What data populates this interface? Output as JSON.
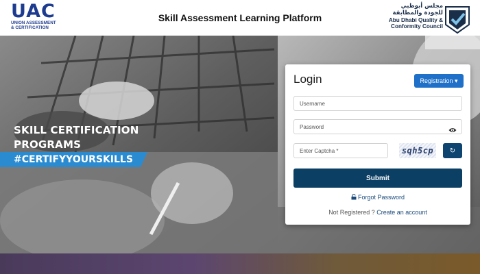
{
  "header": {
    "left_logo": {
      "mark": "UAC",
      "line1": "UNION ASSESSMENT",
      "line2": "& CERTIFICATION"
    },
    "title": "Skill Assessment Learning Platform",
    "right_logo": {
      "arabic_line1": "مجلس أبوظبي",
      "arabic_line2": "للجودة والمطابقة",
      "english_line1": "Abu Dhabi Quality &",
      "english_line2": "Conformity Council"
    }
  },
  "hero": {
    "caption_line1": "SKILL CERTIFICATION",
    "caption_line2": "PROGRAMS",
    "hashtag": "#CERTIFYYOURSKILLS"
  },
  "login": {
    "title": "Login",
    "registration_label": "Registration",
    "username_placeholder": "Username",
    "password_placeholder": "Password",
    "captcha_placeholder": "Enter Captcha *",
    "captcha_text": "sqh5cp",
    "refresh_symbol": "↻",
    "submit_label": "Submit",
    "forgot_label": "Forgot Password",
    "not_registered_text": "Not Registered ?",
    "create_account_label": "Create an account"
  },
  "colors": {
    "brand_blue": "#1d3b8f",
    "registration_button": "#1e70c8",
    "submit_button": "#0b3f63",
    "hashtag_band": "#2a8bd1"
  },
  "icons": [
    "chevron-down-icon",
    "eye-icon",
    "refresh-icon",
    "lock-icon",
    "qcc-check-icon"
  ]
}
